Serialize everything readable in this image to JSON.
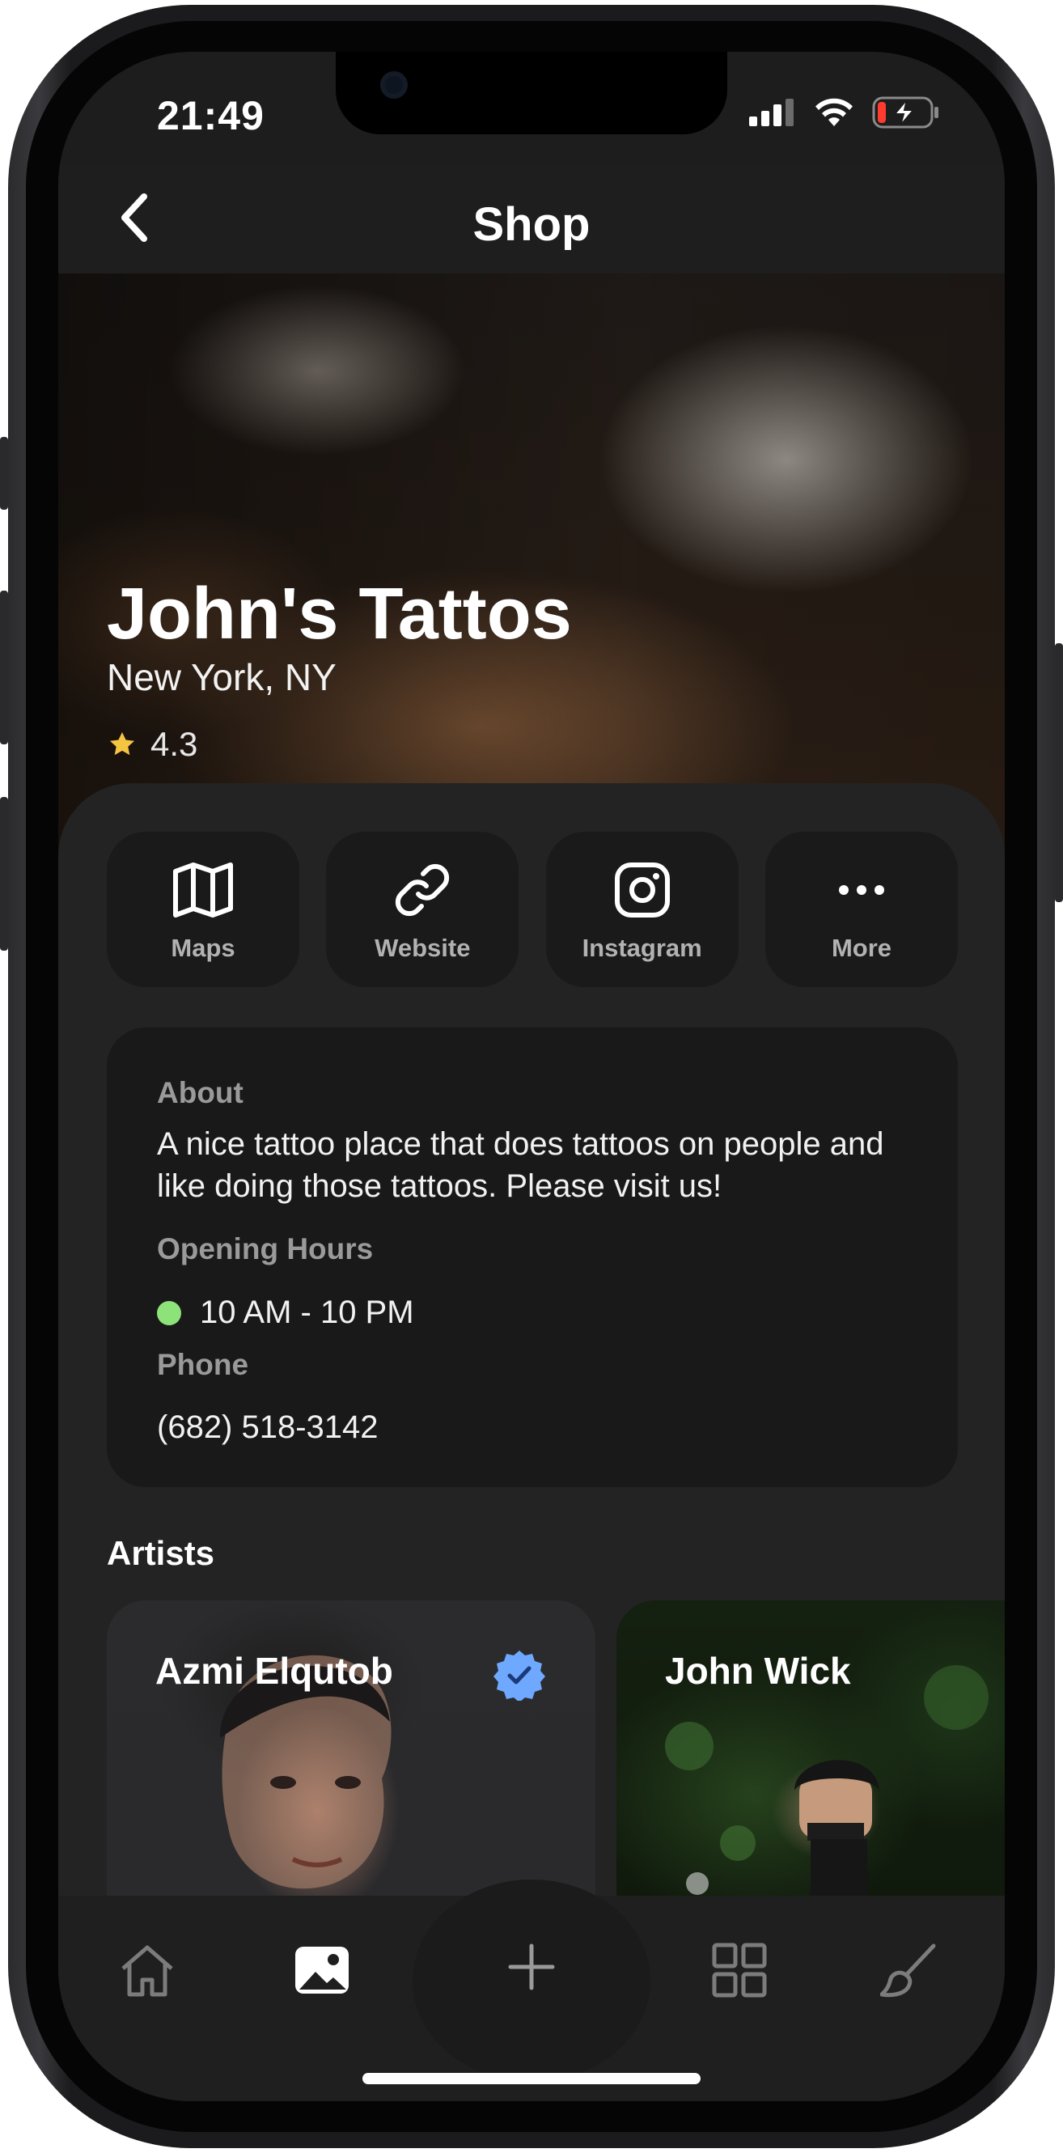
{
  "status_bar": {
    "time": "21:49"
  },
  "nav": {
    "title": "Shop"
  },
  "shop": {
    "name": "John's Tattos",
    "location": "New York, NY",
    "rating": "4.3"
  },
  "actions": [
    {
      "label": "Maps",
      "icon": "map-icon"
    },
    {
      "label": "Website",
      "icon": "link-icon"
    },
    {
      "label": "Instagram",
      "icon": "instagram-icon"
    },
    {
      "label": "More",
      "icon": "more-icon"
    }
  ],
  "info": {
    "about_heading": "About",
    "about_text": "A nice tattoo place that does tattoos on people and like doing those tattoos. Please visit us!",
    "hours_heading": "Opening Hours",
    "hours_value": "10 AM - 10 PM",
    "phone_heading": "Phone",
    "phone_value": "(682) 518-3142"
  },
  "artists_section": {
    "title": "Artists",
    "artists": [
      {
        "name": "Azmi Elqutob",
        "verified": true
      },
      {
        "name": "John Wick",
        "verified": false
      }
    ]
  },
  "tabbar": {
    "items": [
      "home-icon",
      "gallery-icon",
      "plus-icon",
      "grid-icon",
      "brush-icon"
    ],
    "active": "gallery-icon"
  },
  "colors": {
    "background": "#1d1d1d",
    "card": "#191919",
    "open_indicator": "#8ee27a",
    "star": "#f5c542",
    "verified": "#6ea8ff"
  }
}
